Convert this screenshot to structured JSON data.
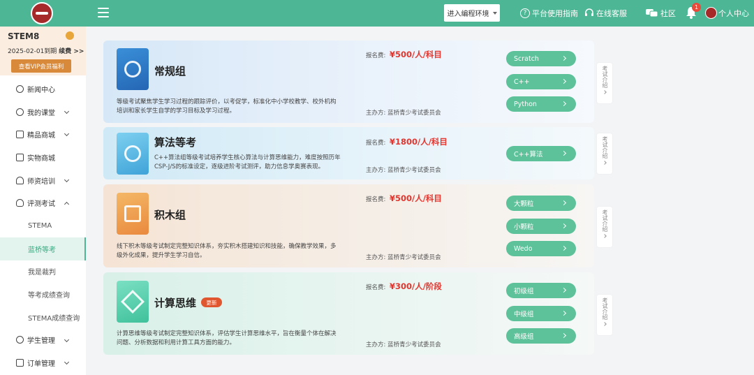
{
  "header": {
    "env_button": "进入编程环境",
    "links": {
      "guide": "平台使用指南",
      "support": "在线客服",
      "community": "社区",
      "notification_count": "1",
      "profile": "个人中心"
    }
  },
  "member": {
    "name": "STEM8",
    "expire": "2025-02-01到期",
    "renew": "续费 >>",
    "vip_button": "查看VIP会员福利"
  },
  "nav": {
    "items": [
      "新闻中心",
      "我的课堂",
      "精品商城",
      "实物商城",
      "师资培训",
      "评测考试"
    ],
    "sub": [
      "STEMA",
      "蓝桥等考",
      "我是裁判",
      "等考成绩查询",
      "STEMA成绩查询"
    ],
    "bottom": [
      "学生管理",
      "订单管理"
    ]
  },
  "cards": [
    {
      "title": "常规组",
      "desc": "等级考试聚焦学生学习过程的跟踪评价，以考促学，标准化中小学校教学、校外机构培训和家长学生自学的学习目标及学习过程。",
      "fee_label": "报名费:",
      "fee": "¥500/人/科目",
      "org": "主办方:  蓝桥青少考试委员会",
      "options": [
        "Scratch",
        "C++",
        "Python"
      ],
      "intro": "考试介绍"
    },
    {
      "title": "算法等考",
      "desc": "C++算法组等级考试培养学生核心算法与计算思维能力，难度按照历年CSP-J/S的标准设定，逐级进阶考试测评，助力信息学奥赛表现。",
      "fee_label": "报名费:",
      "fee": "¥1800/人/科目",
      "org": "主办方:  蓝桥青少考试委员会",
      "options": [
        "C++算法"
      ],
      "intro": "考试介绍"
    },
    {
      "title": "积木组",
      "desc": "线下积木等级考试制定完整知识体系，夯实积木搭建知识和技能，确保教学效果，多级外化成果，提升学生学习自信。",
      "fee_label": "报名费:",
      "fee": "¥500/人/科目",
      "org": "主办方:  蓝桥青少考试委员会",
      "options": [
        "大颗粒",
        "小颗粒",
        "Wedo"
      ],
      "intro": "考试介绍"
    },
    {
      "title": "计算思维",
      "badge": "更新",
      "desc": "计算思维等级考试制定完整知识体系，评估学生计算思维水平，旨在衡量个体在解决问题、分析数据和利用计算工具方面的能力。",
      "fee_label": "报名费:",
      "fee": "¥300/人/阶段",
      "org": "主办方:  蓝桥青少考试委员会",
      "options": [
        "初级组",
        "中级组",
        "高级组"
      ],
      "intro": "考试介绍"
    }
  ],
  "colors": {
    "primary": "#4db795",
    "button": "#5dc19a",
    "fee": "#e4362f",
    "vip": "#d9893a"
  }
}
